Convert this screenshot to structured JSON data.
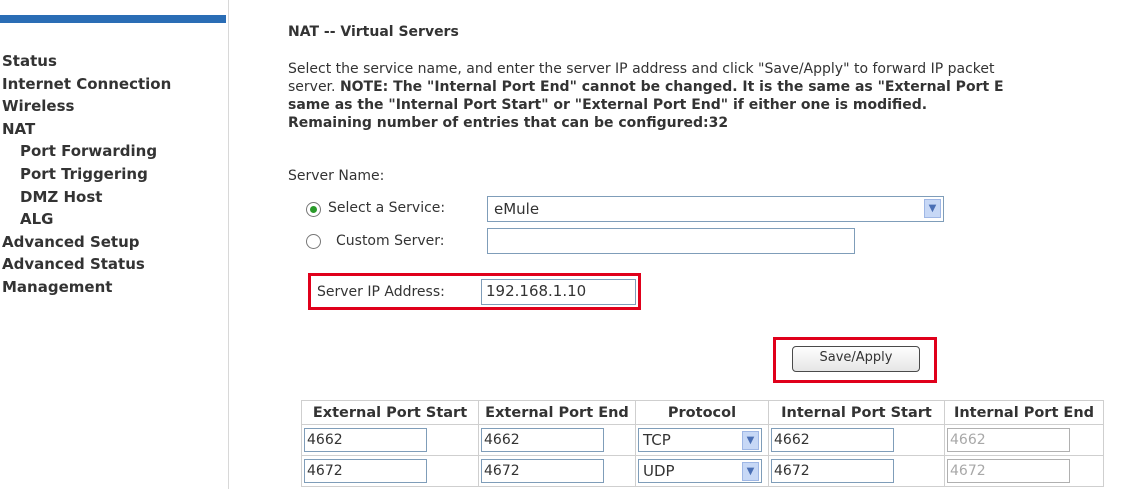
{
  "sidebar": {
    "items": [
      {
        "label": "Status"
      },
      {
        "label": "Internet Connection"
      },
      {
        "label": "Wireless"
      },
      {
        "label": "NAT"
      },
      {
        "label": "Port Forwarding"
      },
      {
        "label": "Port Triggering"
      },
      {
        "label": "DMZ Host"
      },
      {
        "label": "ALG"
      },
      {
        "label": "Advanced Setup"
      },
      {
        "label": "Advanced Status"
      },
      {
        "label": "Management"
      }
    ]
  },
  "page": {
    "title": "NAT -- Virtual Servers",
    "desc_line1": "Select the service name, and enter the server IP address and click \"Save/Apply\" to forward IP packet",
    "desc_line2_a": "server. ",
    "desc_line2_b": "NOTE: The \"Internal Port End\" cannot be changed. It is the same as \"External Port E",
    "desc_line3": "same as the \"Internal Port Start\" or \"External Port End\" if either one is modified.",
    "desc_line4": "Remaining number of entries that can be configured:32"
  },
  "form": {
    "server_name_label": "Server Name:",
    "select_service_label": "Select a Service:",
    "select_service_value": "eMule",
    "custom_server_label": "Custom Server:",
    "custom_server_value": "",
    "server_ip_label": "Server IP Address:",
    "server_ip_value": "192.168.1.10",
    "save_apply_label": "Save/Apply"
  },
  "table": {
    "headers": [
      "External Port Start",
      "External Port End",
      "Protocol",
      "Internal Port Start",
      "Internal Port End"
    ],
    "rows": [
      {
        "ext_start": "4662",
        "ext_end": "4662",
        "protocol": "TCP",
        "int_start": "4662",
        "int_end": "4662"
      },
      {
        "ext_start": "4672",
        "ext_end": "4672",
        "protocol": "UDP",
        "int_start": "4672",
        "int_end": "4672"
      }
    ]
  },
  "colors": {
    "highlight": "#e0001b",
    "nav_bar": "#2a6db5",
    "radio_selected": "#2a9a2a"
  }
}
